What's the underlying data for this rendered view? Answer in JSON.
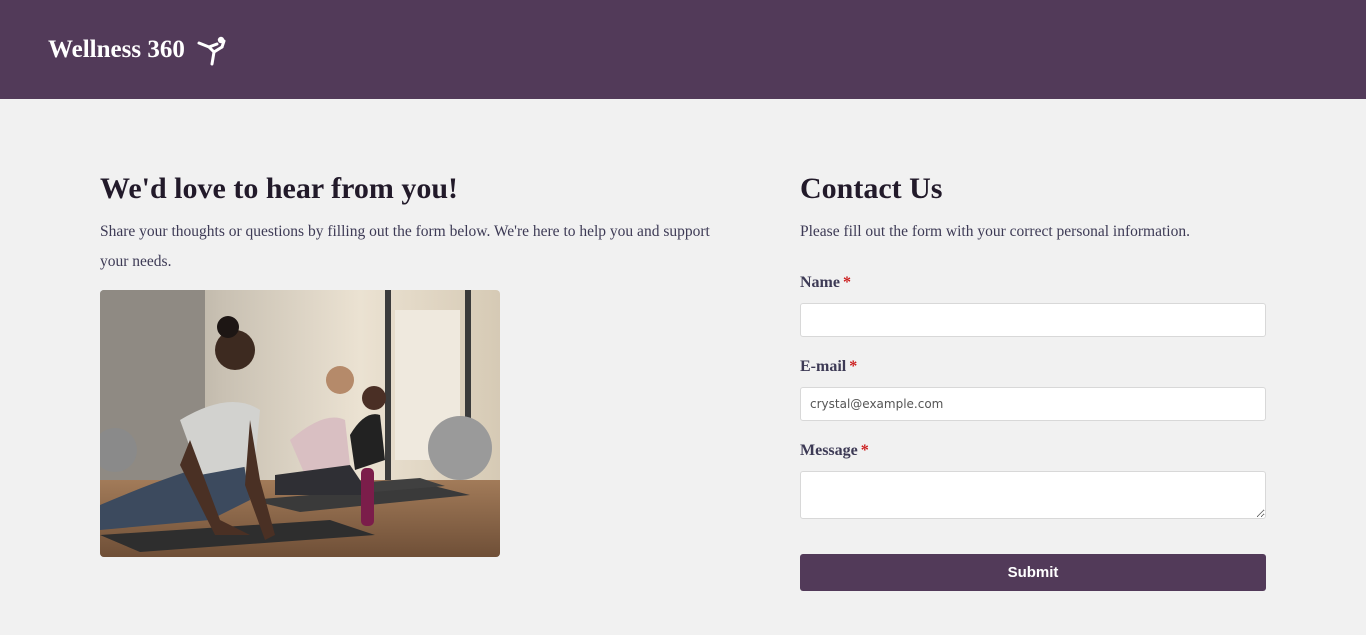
{
  "header": {
    "brand_name": "Wellness 360",
    "brand_icon": "yoga-pose-icon"
  },
  "intro": {
    "heading": "We'd love to hear from you!",
    "description": "Share your thoughts or questions by filling out the form below. We're here to help you and support your needs.",
    "image_alt": "Women practicing yoga in a studio"
  },
  "contact": {
    "heading": "Contact Us",
    "description": "Please fill out the form with your correct personal information.",
    "required_mark": "*",
    "name": {
      "label": "Name",
      "value": "",
      "placeholder": ""
    },
    "email": {
      "label": "E-mail",
      "value": "",
      "placeholder": "crystal@example.com"
    },
    "message": {
      "label": "Message",
      "value": "",
      "placeholder": ""
    },
    "submit_label": "Submit"
  },
  "colors": {
    "brand": "#523a59",
    "background": "#f1f1f1",
    "required": "#cc1f1f"
  }
}
